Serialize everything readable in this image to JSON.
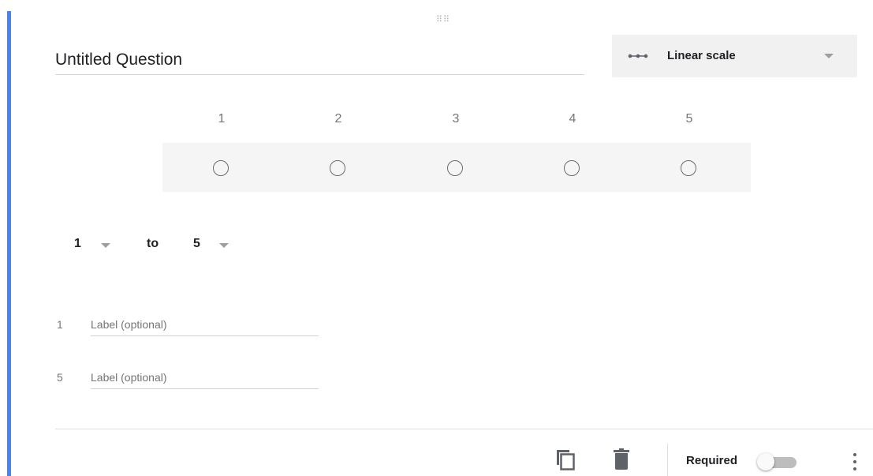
{
  "question": {
    "title": "Untitled Question",
    "type_label": "Linear scale",
    "type_icon": "linear-scale-icon"
  },
  "scale": {
    "labels": [
      "1",
      "2",
      "3",
      "4",
      "5"
    ]
  },
  "range": {
    "min": "1",
    "to": "to",
    "max": "5"
  },
  "endpoint_labels": [
    {
      "num": "1",
      "placeholder": "Label (optional)"
    },
    {
      "num": "5",
      "placeholder": "Label (optional)"
    }
  ],
  "footer": {
    "duplicate_icon": "copy-icon",
    "delete_icon": "trash-icon",
    "required_label": "Required",
    "required_on": false,
    "more_icon": "more-vert-icon"
  },
  "colors": {
    "accent": "#4285f4",
    "dropdown_bg": "#f1f1f1",
    "scale_row_bg": "#f5f5f5"
  }
}
